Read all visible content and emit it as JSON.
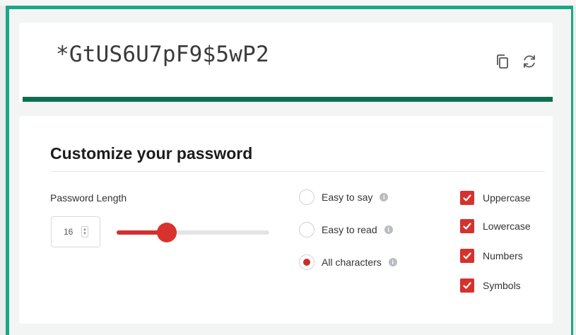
{
  "password": {
    "value": "*GtUS6U7pF9$5wP2",
    "copy_icon": "copy-icon",
    "refresh_icon": "refresh-icon"
  },
  "customize": {
    "title": "Customize your password",
    "length": {
      "label": "Password Length",
      "value": "16",
      "slider_fraction": 0.33
    },
    "modes": [
      {
        "label": "Easy to say",
        "selected": false
      },
      {
        "label": "Easy to read",
        "selected": false
      },
      {
        "label": "All characters",
        "selected": true
      }
    ],
    "options": [
      {
        "label": "Uppercase",
        "checked": true
      },
      {
        "label": "Lowercase",
        "checked": true
      },
      {
        "label": "Numbers",
        "checked": true
      },
      {
        "label": "Symbols",
        "checked": true
      }
    ]
  },
  "colors": {
    "accent_red": "#d8322d",
    "strength_bar": "#0e6e4f",
    "frame_green": "#1aa883"
  }
}
